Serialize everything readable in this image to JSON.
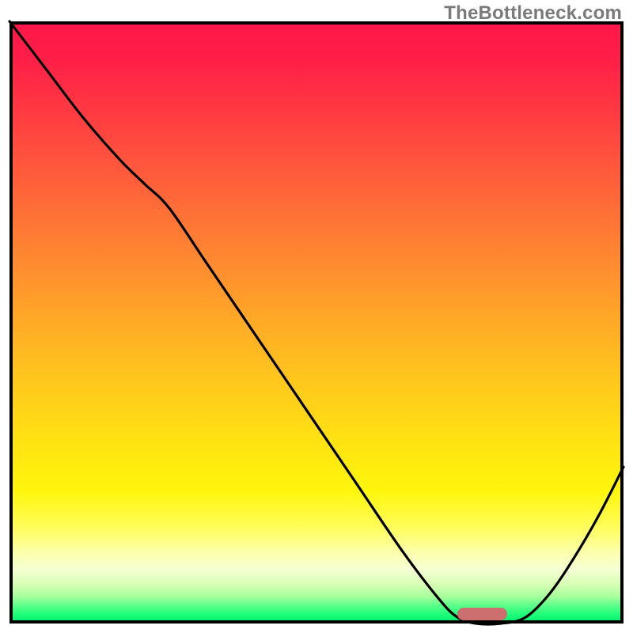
{
  "footer": {
    "credit": "TheBottleneck.com"
  },
  "colors": {
    "curve": "#000000",
    "marker": "#cc6f6e",
    "border": "#000000"
  },
  "chart_data": {
    "type": "line",
    "title": "",
    "xlabel": "",
    "ylabel": "",
    "xlim": [
      0,
      100
    ],
    "ylim": [
      0,
      100
    ],
    "grid": false,
    "legend": false,
    "series": [
      {
        "name": "bottleneck-curve",
        "x": [
          0,
          6,
          12,
          18,
          22,
          26,
          32,
          40,
          48,
          56,
          64,
          70,
          73,
          76,
          80,
          84,
          88,
          92,
          96,
          100
        ],
        "y": [
          100,
          92,
          84,
          77,
          73,
          69,
          60,
          48,
          36,
          24,
          12,
          4,
          1,
          0,
          0,
          1,
          5,
          11,
          18,
          26
        ]
      }
    ],
    "marker": {
      "name": "optimal-range",
      "x_start": 73,
      "x_end": 81,
      "y": 1.6,
      "thickness_pct": 2.1
    }
  }
}
